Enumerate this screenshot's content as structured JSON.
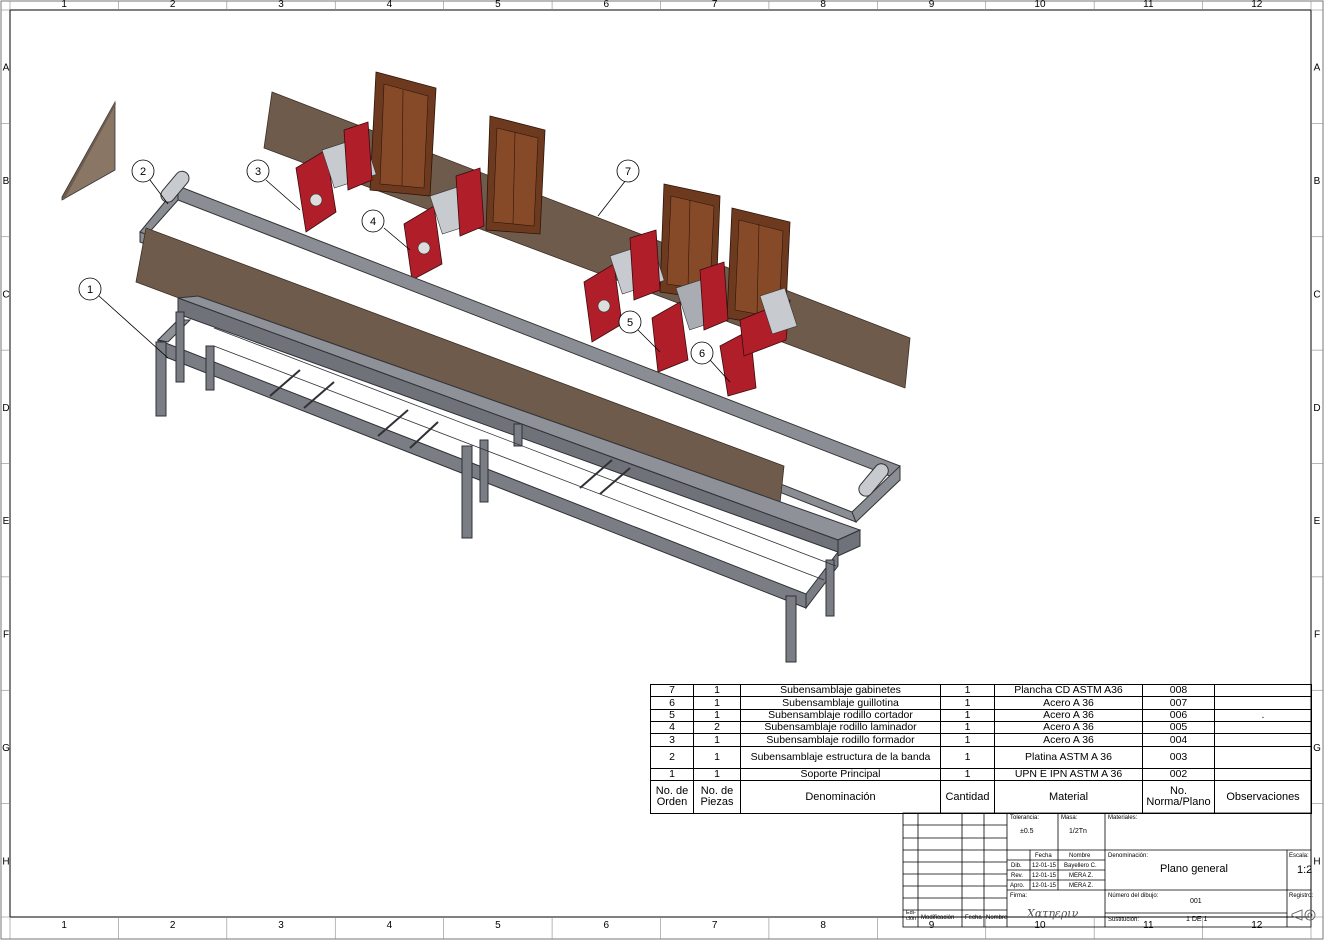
{
  "sheet": {
    "col_labels": [
      "1",
      "2",
      "3",
      "4",
      "5",
      "6",
      "7",
      "8",
      "9",
      "10",
      "11",
      "12"
    ],
    "row_labels": [
      "A",
      "B",
      "C",
      "D",
      "E",
      "F",
      "G",
      "H"
    ]
  },
  "balloons": [
    "1",
    "2",
    "3",
    "4",
    "5",
    "6",
    "7"
  ],
  "bom": {
    "rows": [
      {
        "orden": "7",
        "piezas": "1",
        "denominacion": "Subensamblaje gabinetes",
        "cantidad": "1",
        "material": "Plancha CD ASTM A36",
        "norma": "008",
        "obs": ""
      },
      {
        "orden": "6",
        "piezas": "1",
        "denominacion": "Subensamblaje guillotina",
        "cantidad": "1",
        "material": "Acero A 36",
        "norma": "007",
        "obs": ""
      },
      {
        "orden": "5",
        "piezas": "1",
        "denominacion": "Subensamblaje rodillo cortador",
        "cantidad": "1",
        "material": "Acero A 36",
        "norma": "006",
        "obs": "."
      },
      {
        "orden": "4",
        "piezas": "2",
        "denominacion": "Subensamblaje rodillo laminador",
        "cantidad": "1",
        "material": "Acero A 36",
        "norma": "005",
        "obs": ""
      },
      {
        "orden": "3",
        "piezas": "1",
        "denominacion": "Subensamblaje rodillo formador",
        "cantidad": "1",
        "material": "Acero A 36",
        "norma": "004",
        "obs": ""
      },
      {
        "orden": "2",
        "piezas": "1",
        "denominacion": "Subensamblaje estructura de la banda",
        "cantidad": "1",
        "material": "Platina ASTM A 36",
        "norma": "003",
        "obs": ""
      },
      {
        "orden": "1",
        "piezas": "1",
        "denominacion": "Soporte Principal",
        "cantidad": "1",
        "material": "UPN E IPN ASTM A 36",
        "norma": "002",
        "obs": ""
      }
    ],
    "headers": {
      "orden": "No. de Orden",
      "piezas": "No. de Piezas",
      "denominacion": "Denominación",
      "cantidad": "Cantidad",
      "material": "Material",
      "norma": "No. Norma/Plano",
      "obs": "Observaciones"
    }
  },
  "title_block": {
    "tolerancia_label": "Tolerancia:",
    "tolerancia": "±0.5",
    "masa_label": "Masa:",
    "masa": "1/2Tn",
    "materiales_label": "Materiales:",
    "fecha_label": "Fecha",
    "nombre_label": "Nombre",
    "dib_label": "Dib.",
    "dib_fecha": "12-01-15",
    "dib_nombre": "Bayellero C.",
    "rev_label": "Rev.",
    "rev_fecha": "12-01-15",
    "rev_nombre": "MERA Z.",
    "apro_label": "Apro.",
    "apro_fecha": "12-01-15",
    "apro_nombre": "MERA Z.",
    "firma_label": "Firma:",
    "firma": "Χατηεριν",
    "denominacion_label": "Denominación:",
    "denominacion": "Plano general",
    "escala_label": "Escala:",
    "escala": "1:2",
    "numero_label": "Número del dibujo:",
    "numero": "001",
    "registro_label": "Registro:",
    "sustitucion_label": "Sustitución:",
    "hoja": "1 DE 1",
    "edicion_label": "Edi-ción",
    "modificacion_label": "Modificación",
    "fecha2_label": "Fecha",
    "nombre2_label": "Nombre"
  },
  "colors": {
    "plate": "#6f5b4b",
    "cabinet": "#6e3a1f",
    "guillotine": "#b01e2a",
    "frame": "#7a7d84"
  }
}
